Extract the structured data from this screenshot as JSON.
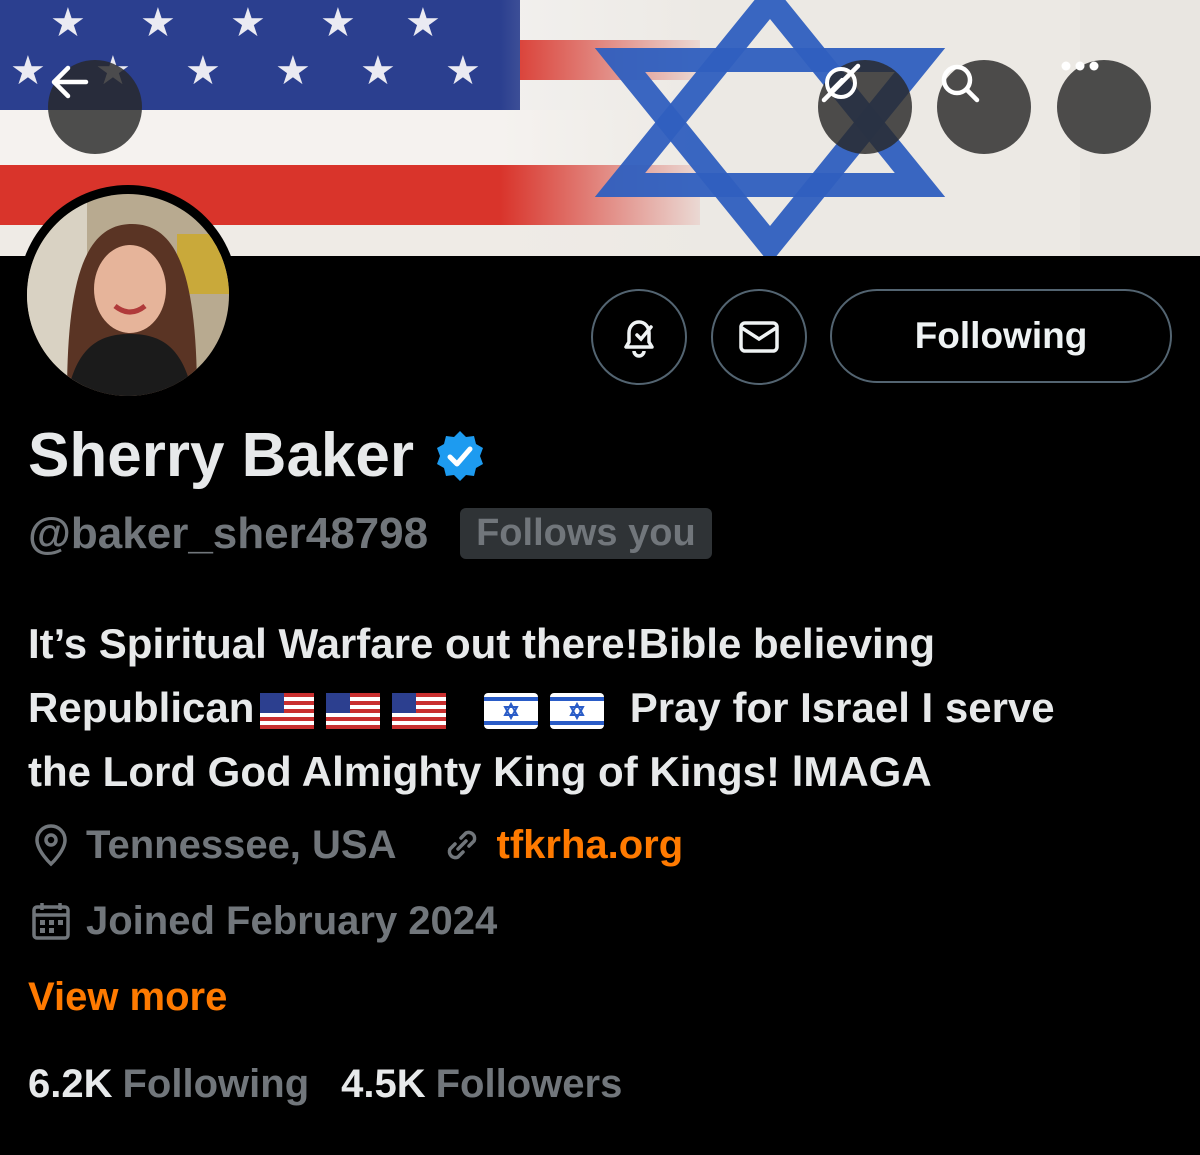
{
  "banner": {
    "description_icon": "us-israel-flag-banner"
  },
  "header": {
    "back_icon": "back-arrow-icon",
    "grok_icon": "grok-icon",
    "search_icon": "search-icon",
    "more_icon": "more-icon"
  },
  "actions": {
    "notify_icon": "bell-check-icon",
    "message_icon": "mail-icon",
    "following_label": "Following"
  },
  "profile": {
    "name": "Sherry Baker",
    "verified_icon": "verified-badge-icon",
    "handle": "@baker_sher48798",
    "follows_you": "Follows you",
    "bio_line1": "It’s Spiritual Warfare out there!Bible believing",
    "bio_republican": "Republican",
    "bio_pray": "Pray for Israel I serve",
    "bio_line3": "the Lord God Almighty King of Kings! lMAGA",
    "location": "Tennessee, USA",
    "website": "tfkrha.org",
    "joined": "Joined February 2024",
    "view_more": "View more"
  },
  "stats": {
    "following_count": "6.2K",
    "following_label": "Following",
    "followers_count": "4.5K",
    "followers_label": "Followers"
  },
  "colors": {
    "accent": "#ff7a00",
    "verified": "#1d9bf0",
    "muted": "#71767b"
  }
}
